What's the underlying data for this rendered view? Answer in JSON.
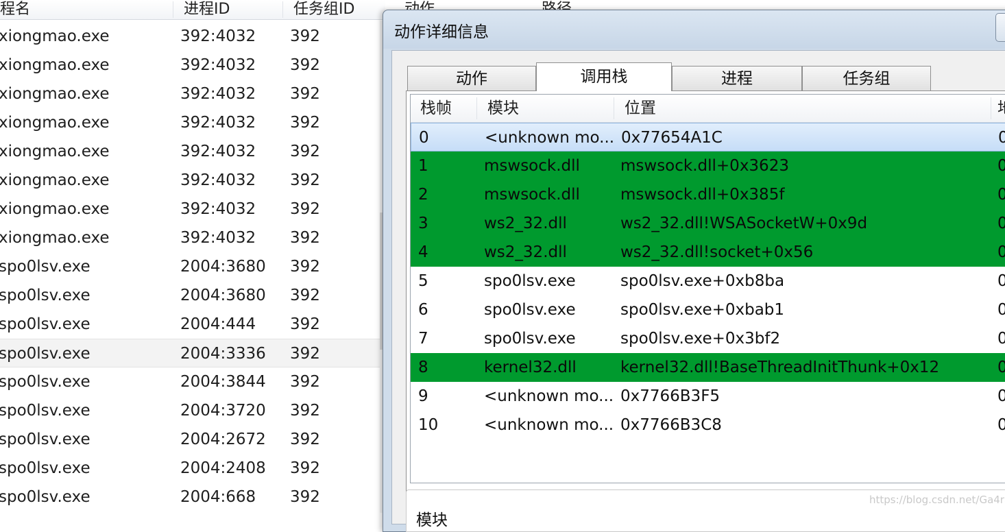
{
  "background_list": {
    "columns": [
      "程名",
      "进程ID",
      "任务组ID",
      "动作",
      "路径"
    ],
    "rows": [
      {
        "name": "xiongmao.exe",
        "pid": "392:4032",
        "group": "392"
      },
      {
        "name": "xiongmao.exe",
        "pid": "392:4032",
        "group": "392"
      },
      {
        "name": "xiongmao.exe",
        "pid": "392:4032",
        "group": "392"
      },
      {
        "name": "xiongmao.exe",
        "pid": "392:4032",
        "group": "392"
      },
      {
        "name": "xiongmao.exe",
        "pid": "392:4032",
        "group": "392"
      },
      {
        "name": "xiongmao.exe",
        "pid": "392:4032",
        "group": "392"
      },
      {
        "name": "xiongmao.exe",
        "pid": "392:4032",
        "group": "392"
      },
      {
        "name": "xiongmao.exe",
        "pid": "392:4032",
        "group": "392"
      },
      {
        "name": "spo0lsv.exe",
        "pid": "2004:3680",
        "group": "392"
      },
      {
        "name": "spo0lsv.exe",
        "pid": "2004:3680",
        "group": "392"
      },
      {
        "name": "spo0lsv.exe",
        "pid": "2004:444",
        "group": "392"
      },
      {
        "name": "spo0lsv.exe",
        "pid": "2004:3336",
        "group": "392"
      },
      {
        "name": "spo0lsv.exe",
        "pid": "2004:3844",
        "group": "392"
      },
      {
        "name": "spo0lsv.exe",
        "pid": "2004:3720",
        "group": "392"
      },
      {
        "name": "spo0lsv.exe",
        "pid": "2004:2672",
        "group": "392"
      },
      {
        "name": "spo0lsv.exe",
        "pid": "2004:2408",
        "group": "392"
      },
      {
        "name": "spo0lsv.exe",
        "pid": "2004:668",
        "group": "392"
      }
    ],
    "selected_row": 11
  },
  "dialog": {
    "title": "动作详细信息",
    "tabs": [
      "动作",
      "调用栈",
      "进程",
      "任务组"
    ],
    "active_tab": 1,
    "stack_table": {
      "columns": [
        "栈帧",
        "模块",
        "位置",
        "地"
      ],
      "rows": [
        {
          "frame": "0",
          "module": "<unknown mo...",
          "location": "0x77654A1C",
          "extra": "0",
          "state": "focus"
        },
        {
          "frame": "1",
          "module": "mswsock.dll",
          "location": "mswsock.dll+0x3623",
          "extra": "0",
          "state": "highlight"
        },
        {
          "frame": "2",
          "module": "mswsock.dll",
          "location": "mswsock.dll+0x385f",
          "extra": "0",
          "state": "highlight"
        },
        {
          "frame": "3",
          "module": "ws2_32.dll",
          "location": "ws2_32.dll!WSASocketW+0x9d",
          "extra": "0",
          "state": "highlight"
        },
        {
          "frame": "4",
          "module": "ws2_32.dll",
          "location": "ws2_32.dll!socket+0x56",
          "extra": "0",
          "state": "highlight"
        },
        {
          "frame": "5",
          "module": "spo0lsv.exe",
          "location": "spo0lsv.exe+0xb8ba",
          "extra": "0",
          "state": "normal"
        },
        {
          "frame": "6",
          "module": "spo0lsv.exe",
          "location": "spo0lsv.exe+0xbab1",
          "extra": "0",
          "state": "normal"
        },
        {
          "frame": "7",
          "module": "spo0lsv.exe",
          "location": "spo0lsv.exe+0x3bf2",
          "extra": "0",
          "state": "normal"
        },
        {
          "frame": "8",
          "module": "kernel32.dll",
          "location": "kernel32.dll!BaseThreadInitThunk+0x12",
          "extra": "0",
          "state": "highlight"
        },
        {
          "frame": "9",
          "module": "<unknown mo...",
          "location": "0x7766B3F5",
          "extra": "0",
          "state": "normal"
        },
        {
          "frame": "10",
          "module": "<unknown mo...",
          "location": "0x7766B3C8",
          "extra": "0",
          "state": "normal"
        }
      ]
    },
    "detail_label": "模块"
  },
  "watermark": "https://blog.csdn.net/Ga4ra",
  "colors": {
    "highlight_row": "#009a2e",
    "focus_row": "#cfe3f8",
    "dialog_frame": "#cfdcea"
  }
}
